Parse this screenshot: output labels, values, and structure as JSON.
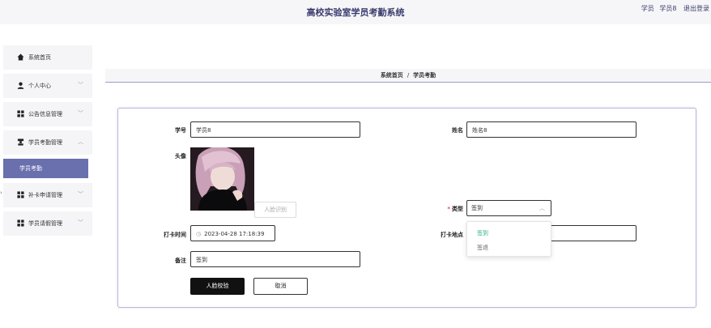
{
  "header": {
    "title": "高校实验室学员考勤系统",
    "user_role": "学员",
    "user_name": "学员8",
    "logout": "退出登录"
  },
  "sidebar": {
    "items": [
      {
        "label": "系统首页",
        "icon": "home-icon"
      },
      {
        "label": "个人中心",
        "icon": "user-icon"
      },
      {
        "label": "公告信息管理",
        "icon": "grid-icon"
      },
      {
        "label": "学员考勤管理",
        "icon": "grid-icon"
      },
      {
        "label": "补卡申请管理",
        "icon": "grid-icon"
      },
      {
        "label": "学员请假管理",
        "icon": "grid-icon"
      }
    ],
    "active_sub": "学员考勤"
  },
  "breadcrumb": {
    "home": "系统首页",
    "sep": "/",
    "current": "学员考勤"
  },
  "form": {
    "student_id_label": "学号",
    "student_id_value": "学员8",
    "name_label": "姓名",
    "name_value": "姓名8",
    "avatar_label": "头像",
    "face_button": "人脸识别",
    "type_label": "类型",
    "type_required": "*",
    "type_value": "签到",
    "type_options": [
      "签到",
      "签退"
    ],
    "time_label": "打卡时间",
    "time_value": "2023-04-28 17:18:39",
    "place_label": "打卡地点",
    "place_value": "",
    "remark_label": "备注",
    "remark_value": "签到",
    "submit_button": "人脸校验",
    "cancel_button": "取消"
  },
  "colors": {
    "accent": "#6a6fad",
    "selected_option": "#2fb38a",
    "required": "#e0463c"
  }
}
